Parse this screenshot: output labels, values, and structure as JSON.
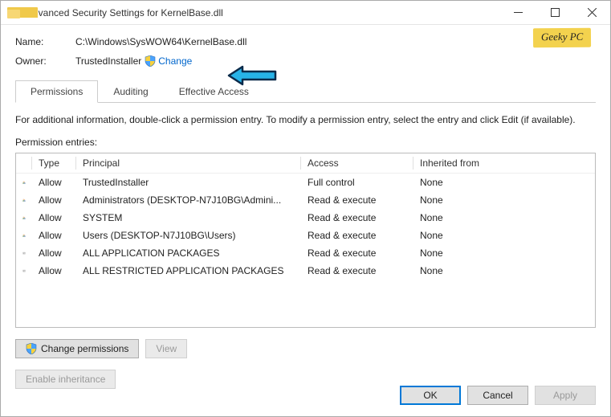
{
  "window": {
    "title": "Advanced Security Settings for KernelBase.dll"
  },
  "badge": "Geeky PC",
  "info": {
    "name_label": "Name:",
    "name_value": "C:\\Windows\\SysWOW64\\KernelBase.dll",
    "owner_label": "Owner:",
    "owner_value": "TrustedInstaller",
    "change_label": "Change"
  },
  "tabs": {
    "permissions": "Permissions",
    "auditing": "Auditing",
    "effective": "Effective Access"
  },
  "desc": "For additional information, double-click a permission entry. To modify a permission entry, select the entry and click Edit (if available).",
  "entries_label": "Permission entries:",
  "columns": {
    "type": "Type",
    "principal": "Principal",
    "access": "Access",
    "inherited": "Inherited from"
  },
  "rows": [
    {
      "icon": "group",
      "type": "Allow",
      "principal": "TrustedInstaller",
      "access": "Full control",
      "inherited": "None"
    },
    {
      "icon": "group",
      "type": "Allow",
      "principal": "Administrators (DESKTOP-N7J10BG\\Admini...",
      "access": "Read & execute",
      "inherited": "None"
    },
    {
      "icon": "group",
      "type": "Allow",
      "principal": "SYSTEM",
      "access": "Read & execute",
      "inherited": "None"
    },
    {
      "icon": "group",
      "type": "Allow",
      "principal": "Users (DESKTOP-N7J10BG\\Users)",
      "access": "Read & execute",
      "inherited": "None"
    },
    {
      "icon": "pkg",
      "type": "Allow",
      "principal": "ALL APPLICATION PACKAGES",
      "access": "Read & execute",
      "inherited": "None"
    },
    {
      "icon": "pkg",
      "type": "Allow",
      "principal": "ALL RESTRICTED APPLICATION PACKAGES",
      "access": "Read & execute",
      "inherited": "None"
    }
  ],
  "buttons": {
    "change_perms": "Change permissions",
    "view": "View",
    "enable_inherit": "Enable inheritance",
    "ok": "OK",
    "cancel": "Cancel",
    "apply": "Apply"
  }
}
